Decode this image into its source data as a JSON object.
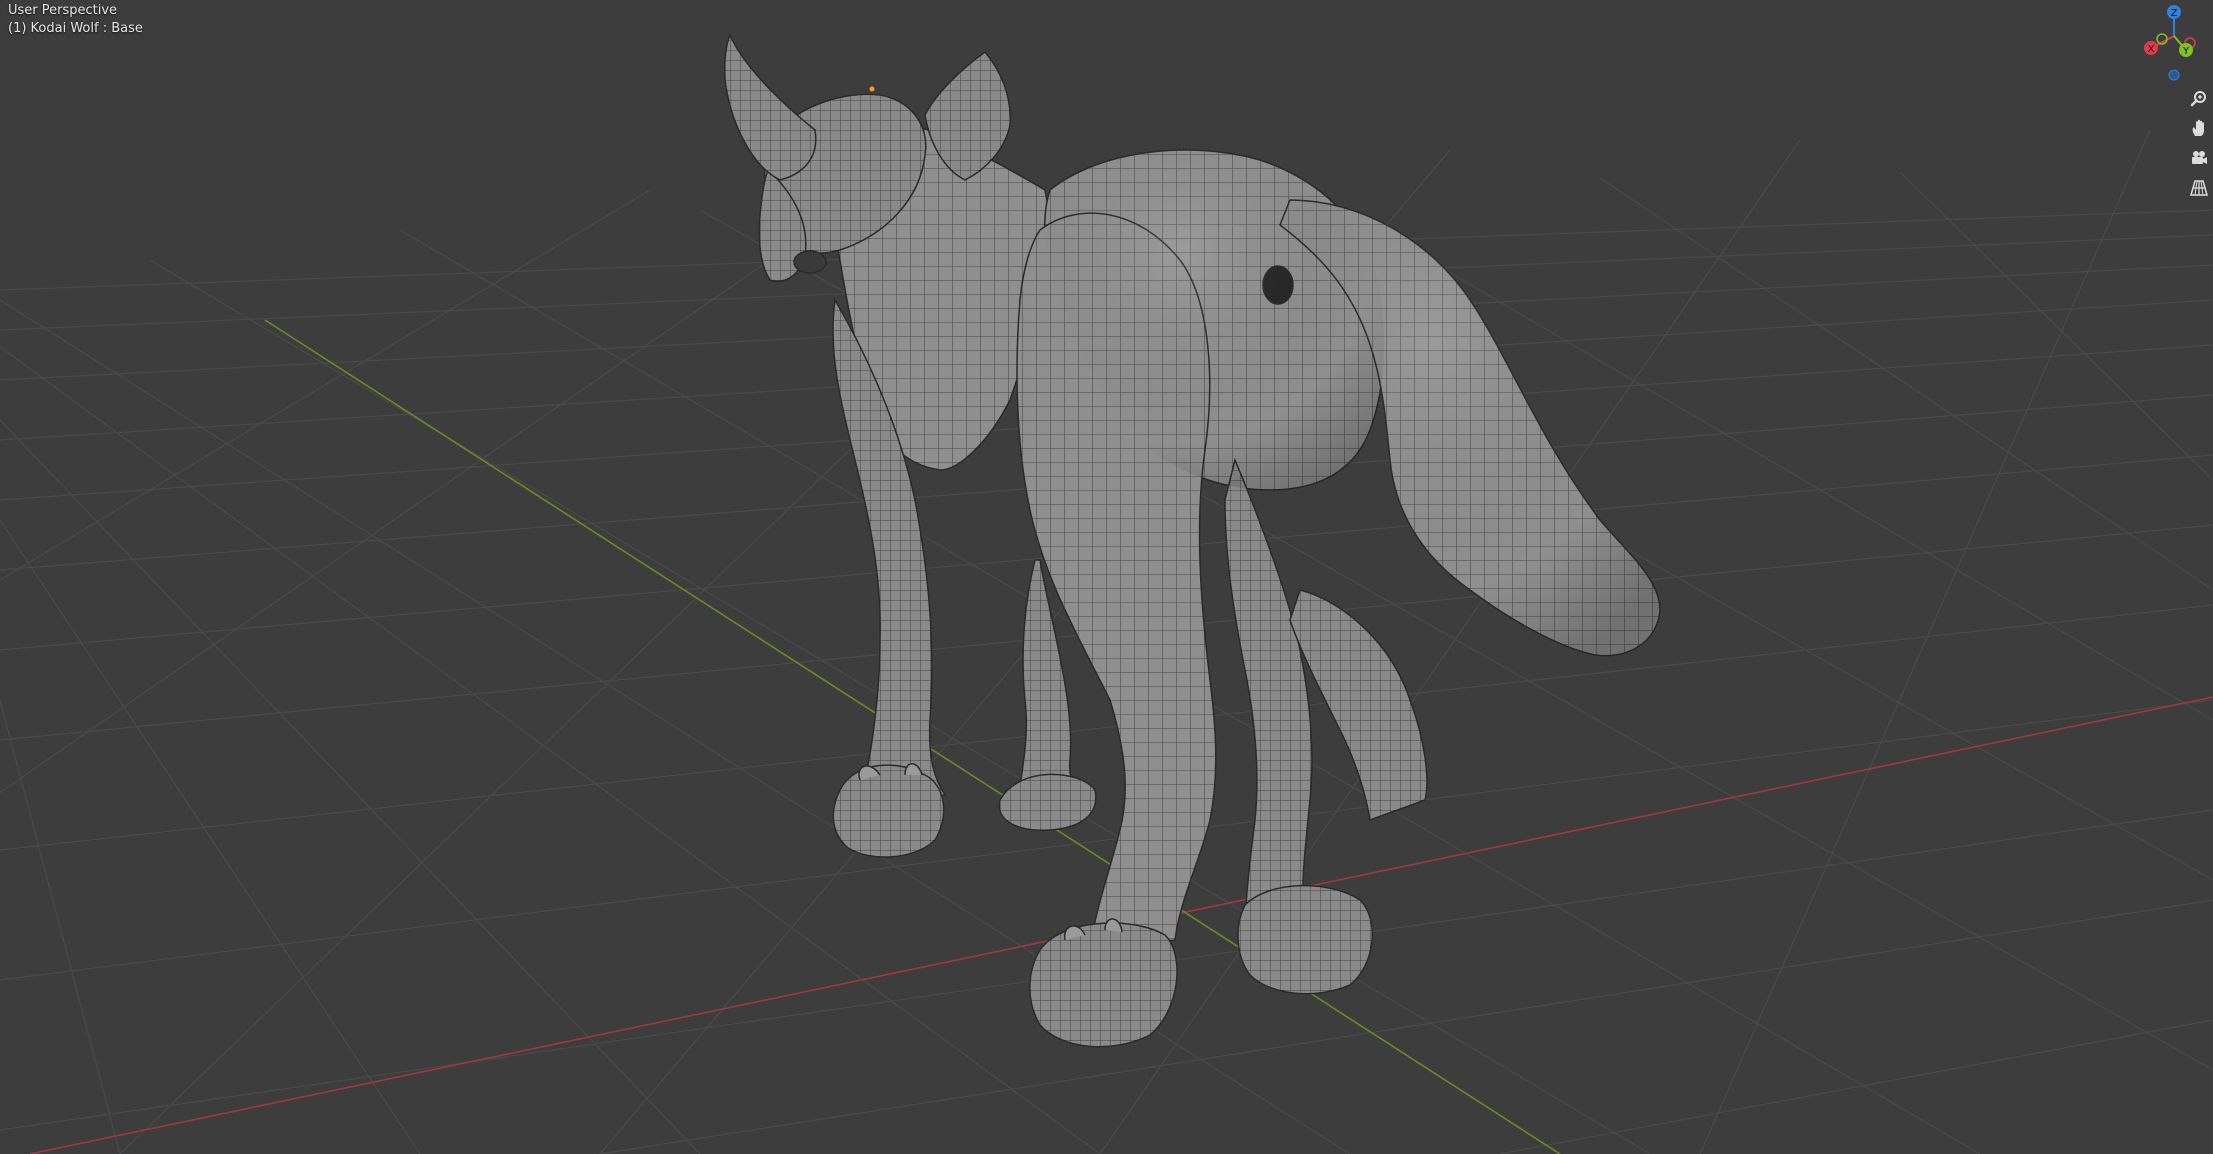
{
  "viewport": {
    "view_name": "User Perspective",
    "object_info": "(1) Kodai Wolf : Base"
  },
  "gizmo": {
    "axes": [
      {
        "label": "Z",
        "color": "#2f83e0"
      },
      {
        "label": "Y",
        "color": "#7ec224"
      },
      {
        "label": "X",
        "color": "#e2394f"
      }
    ]
  },
  "navigation": {
    "buttons": [
      {
        "name": "zoom",
        "icon": "magnifier-icon"
      },
      {
        "name": "pan",
        "icon": "hand-icon"
      },
      {
        "name": "camera",
        "icon": "camera-icon"
      },
      {
        "name": "perspective",
        "icon": "grid-perspective-icon"
      }
    ]
  },
  "colors": {
    "background": "#3d3d3d",
    "grid_line": "#4a4a4a",
    "x_axis": "#a0393f",
    "y_axis": "#6a8a2a",
    "mesh_fill": "#8e8e8e",
    "mesh_wire": "#2b2b2b",
    "origin_dot": "#ff9c1a"
  }
}
